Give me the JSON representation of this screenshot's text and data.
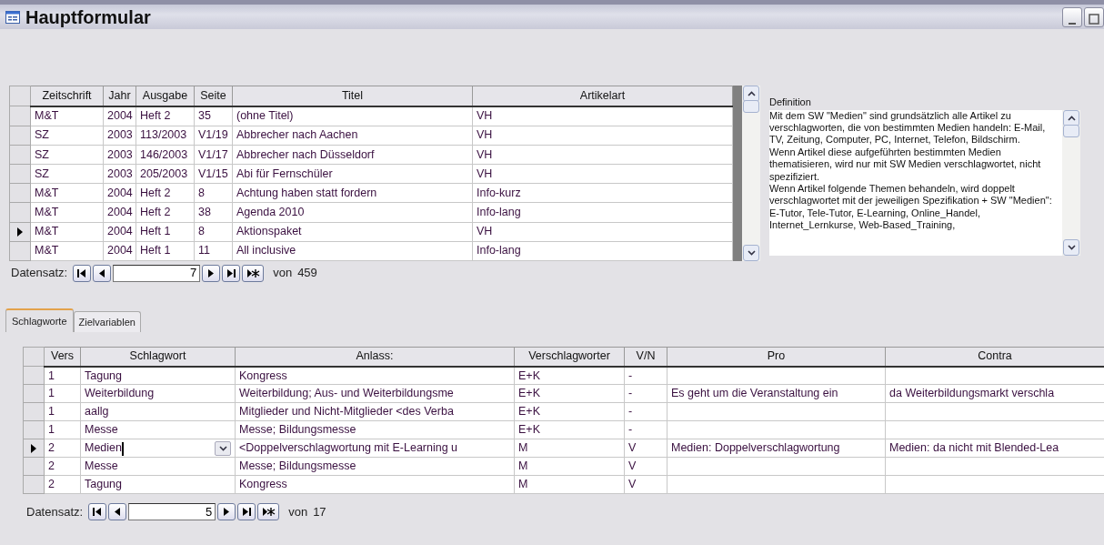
{
  "window": {
    "title": "Hauptformular"
  },
  "articles": {
    "columns": [
      "Zeitschrift",
      "Jahr",
      "Ausgabe",
      "Seite",
      "Titel",
      "Artikelart"
    ],
    "rows": [
      {
        "cells": [
          "M&T",
          "2004",
          "Heft 2",
          "35",
          "(ohne Titel)",
          "VH"
        ],
        "selected": false
      },
      {
        "cells": [
          "SZ",
          "2003",
          "113/2003",
          "V1/19",
          "Abbrecher nach Aachen",
          "VH"
        ],
        "selected": false
      },
      {
        "cells": [
          "SZ",
          "2003",
          "146/2003",
          "V1/17",
          "Abbrecher nach Düsseldorf",
          "VH"
        ],
        "selected": false
      },
      {
        "cells": [
          "SZ",
          "2003",
          "205/2003",
          "V1/15",
          "Abi für Fernschüler",
          "VH"
        ],
        "selected": false
      },
      {
        "cells": [
          "M&T",
          "2004",
          "Heft 2",
          "8",
          "Achtung haben statt fordern",
          "Info-kurz"
        ],
        "selected": false
      },
      {
        "cells": [
          "M&T",
          "2004",
          "Heft 2",
          "38",
          "Agenda 2010",
          "Info-lang"
        ],
        "selected": false
      },
      {
        "cells": [
          "M&T",
          "2004",
          "Heft 1",
          "8",
          "Aktionspaket",
          "VH"
        ],
        "selected": true
      },
      {
        "cells": [
          "M&T",
          "2004",
          "Heft 1",
          "11",
          "All inclusive",
          "Info-lang"
        ],
        "selected": false
      }
    ],
    "navigator": {
      "label": "Datensatz:",
      "current": "7",
      "total_label": "von",
      "total": "459"
    }
  },
  "definition": {
    "label": "Definition",
    "text": "Mit dem SW \"Medien\" sind grundsätzlich alle Artikel zu verschlagworten, die von bestimmten Medien handeln: E-Mail, TV, Zeitung, Computer, PC, Internet, Telefon, Bildschirm.\nWenn Artikel diese aufgeführten bestimmten Medien thematisieren, wird nur mit SW Medien verschlagwortet, nicht spezifiziert.\nWenn Artikel folgende Themen behandeln, wird doppelt verschlagwortet mit der jeweiligen Spezifikation + SW \"Medien\":\nE-Tutor, Tele-Tutor, E-Learning, Online_Handel, Internet_Lernkurse, Web-Based_Training,"
  },
  "tabs": [
    {
      "label": "Schlagworte",
      "selected": true
    },
    {
      "label": "Zielvariablen",
      "selected": false
    }
  ],
  "keywords": {
    "columns": [
      "Vers",
      "Schlagwort",
      "Anlass:",
      "Verschlagworter",
      "V/N",
      "Pro",
      "Contra"
    ],
    "rows": [
      {
        "cells": [
          "1",
          "Tagung",
          "Kongress",
          "E+K",
          "-",
          "",
          ""
        ],
        "selected": false
      },
      {
        "cells": [
          "1",
          "Weiterbildung",
          "Weiterbildung; Aus- und Weiterbildungsme",
          "E+K",
          "-",
          "Es geht um die Veranstaltung ein",
          "da Weiterbildungsmarkt verschla"
        ],
        "selected": false
      },
      {
        "cells": [
          "1",
          "aallg",
          "Mitglieder und Nicht-Mitglieder <des Verba",
          "E+K",
          "-",
          "",
          ""
        ],
        "selected": false
      },
      {
        "cells": [
          "1",
          "Messe",
          "Messe; Bildungsmesse",
          "E+K",
          "-",
          "",
          ""
        ],
        "selected": false
      },
      {
        "cells": [
          "2",
          "Medien",
          "<Doppelverschlagwortung mit E-Learning u",
          "M",
          "V",
          "Medien: Doppelverschlagwortung",
          "Medien: da nicht mit Blended-Lea"
        ],
        "selected": true
      },
      {
        "cells": [
          "2",
          "Messe",
          "Messe; Bildungsmesse",
          "M",
          "V",
          "",
          ""
        ],
        "selected": false
      },
      {
        "cells": [
          "2",
          "Tagung",
          "Kongress",
          "M",
          "V",
          "",
          ""
        ],
        "selected": false
      }
    ],
    "navigator": {
      "label": "Datensatz:",
      "current": "5",
      "total_label": "von",
      "total": "17"
    }
  }
}
